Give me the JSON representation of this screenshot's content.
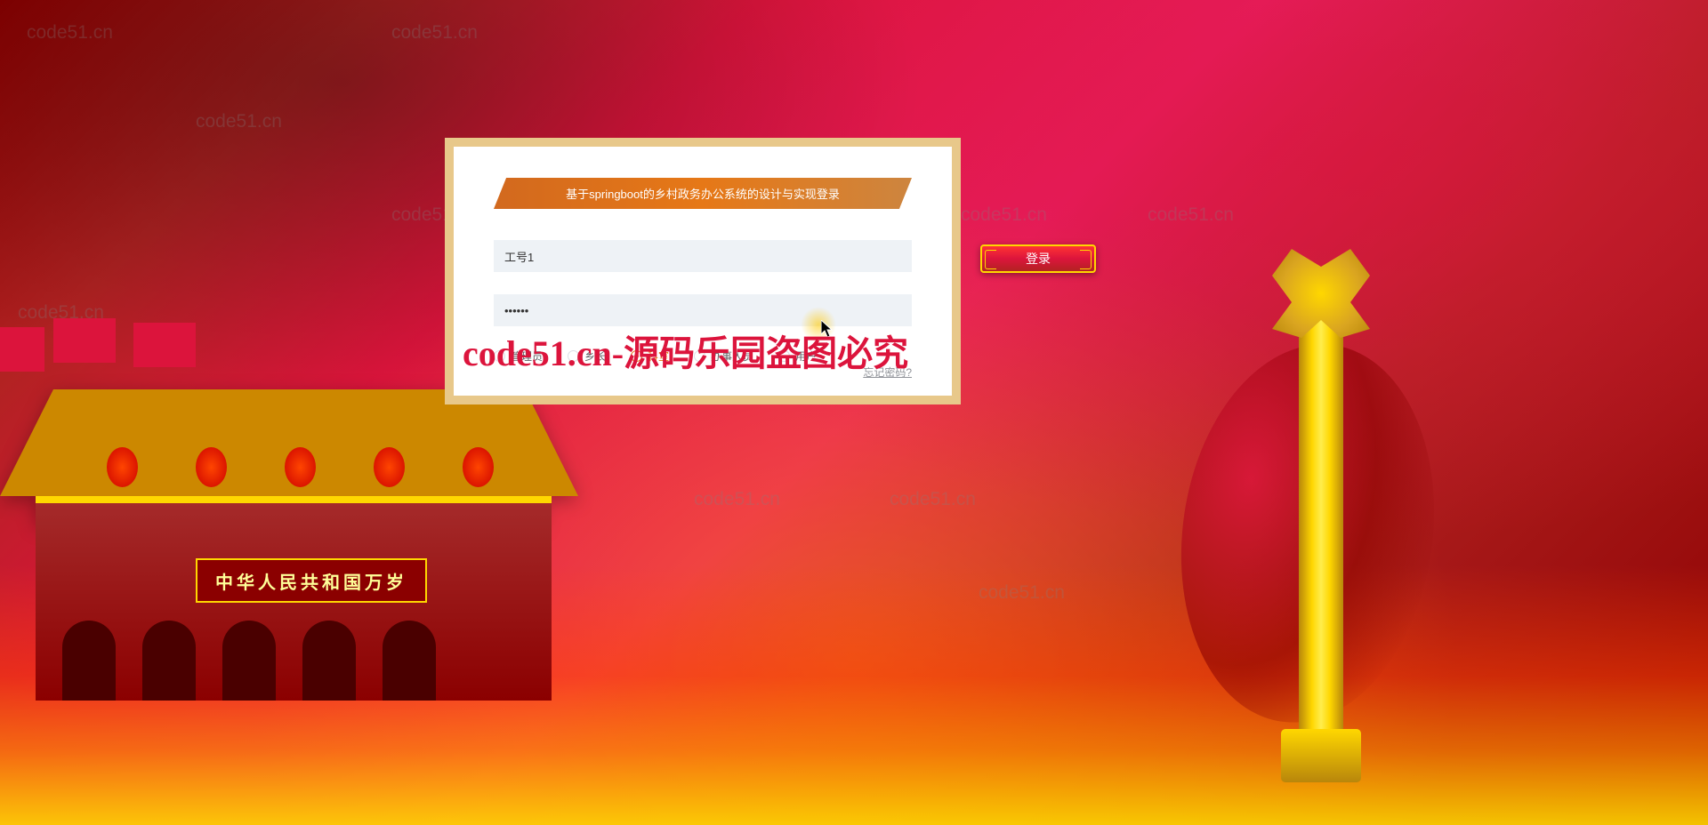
{
  "login": {
    "title": "基于springboot的乡村政务办公系统的设计与实现登录",
    "username_value": "工号1",
    "password_value": "••••••",
    "roles": [
      {
        "label": "管理员",
        "selected": false
      },
      {
        "label": "乡长",
        "selected": false
      },
      {
        "label": "科室",
        "selected": true
      },
      {
        "label": "办事人员",
        "selected": false
      },
      {
        "label": "用户",
        "selected": false
      }
    ],
    "forgot_label": "忘记密码?",
    "login_button_label": "登录"
  },
  "building": {
    "banner_text": "中华人民共和国万岁"
  },
  "watermark": {
    "text": "code51.cn",
    "main_text": "code51.cn-源码乐园盗图必究"
  }
}
